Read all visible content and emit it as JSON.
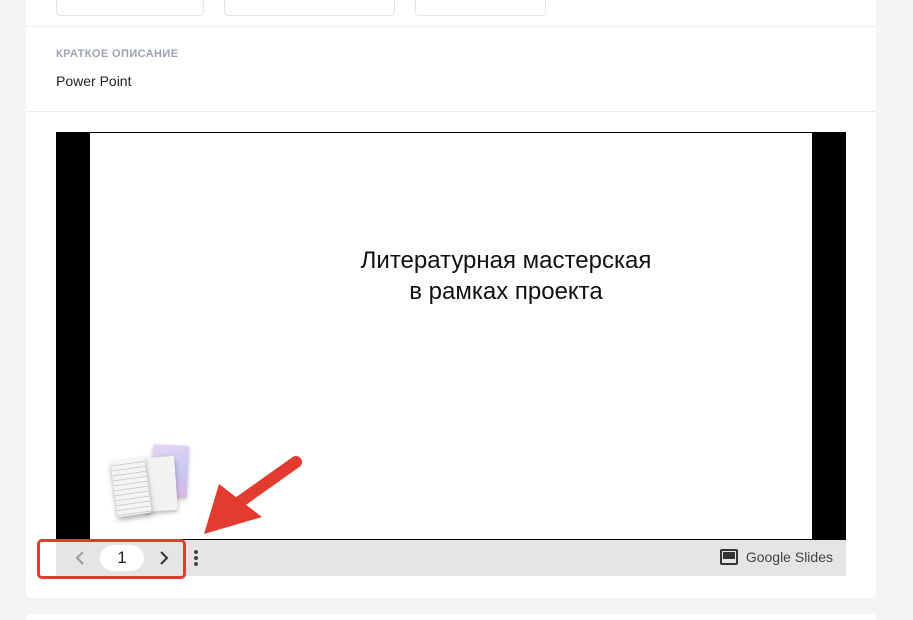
{
  "description": {
    "label": "КРАТКОЕ ОПИСАНИЕ",
    "value": "Power Point"
  },
  "slides_embed": {
    "slide_title_line1": "Литературная мастерская",
    "slide_title_line2": "в рамках проекта",
    "page_number": "1",
    "brand_label": "Google Slides"
  },
  "icons": {
    "prev": "chevron-left-icon",
    "next": "chevron-right-icon",
    "more": "more-vert-icon",
    "brand": "google-slides-icon",
    "annotation": "red-arrow-icon"
  },
  "colors": {
    "page_background": "#f3f4f6",
    "card_background": "#ffffff",
    "label": "#97a3b6",
    "controls_bar": "#e5e5e5",
    "annotation": "#e43b30"
  }
}
